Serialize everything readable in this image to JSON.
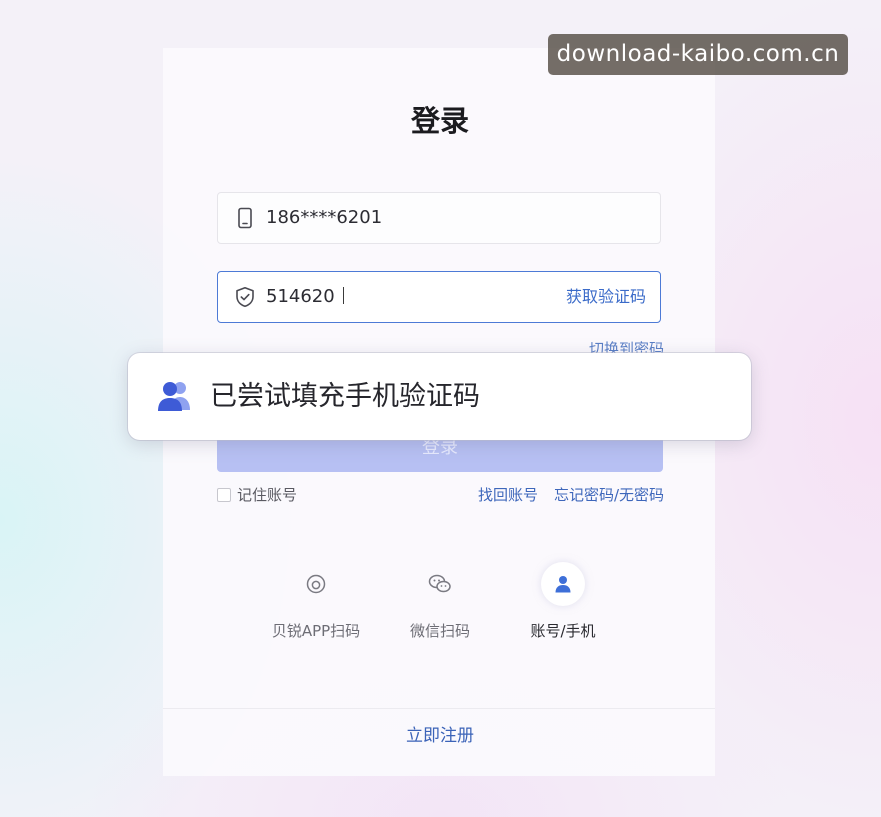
{
  "watermark": "download-kaibo.com.cn",
  "page_title": "登录",
  "phone_field": {
    "value": "186****6201"
  },
  "code_field": {
    "value": "514620",
    "get_code_label": "获取验证码"
  },
  "switch_password_label": "切换到密码",
  "login_button_label": "登录",
  "toast": {
    "text": "已尝试填充手机验证码"
  },
  "remember_label": "记住账号",
  "find_account_label": "找回账号",
  "forgot_password_label": "忘记密码/无密码",
  "login_methods": [
    {
      "label": "贝锐APP扫码",
      "icon": "app-scan-icon"
    },
    {
      "label": "微信扫码",
      "icon": "wechat-icon"
    },
    {
      "label": "账号/手机",
      "icon": "user-icon"
    }
  ],
  "register_label": "立即注册",
  "colors": {
    "accent": "#3b6bc9",
    "login_button": "#b7c0f3",
    "toast_icon": "#3e5bd6"
  }
}
